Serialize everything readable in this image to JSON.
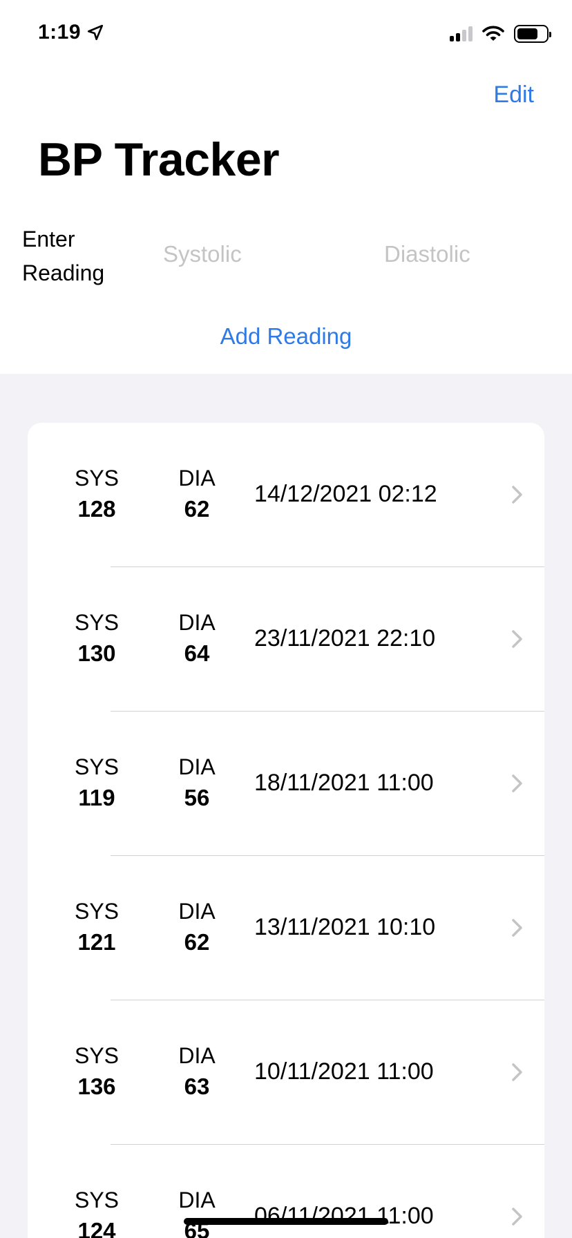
{
  "status_bar": {
    "time": "1:19"
  },
  "nav": {
    "edit_label": "Edit",
    "title": "BP Tracker"
  },
  "entry": {
    "label": "Enter Reading",
    "systolic_placeholder": "Systolic",
    "diastolic_placeholder": "Diastolic",
    "add_label": "Add Reading"
  },
  "readings": [
    {
      "sys_label": "SYS",
      "sys": "128",
      "dia_label": "DIA",
      "dia": "62",
      "date": "14/12/2021 02:12"
    },
    {
      "sys_label": "SYS",
      "sys": "130",
      "dia_label": "DIA",
      "dia": "64",
      "date": "23/11/2021 22:10"
    },
    {
      "sys_label": "SYS",
      "sys": "119",
      "dia_label": "DIA",
      "dia": "56",
      "date": "18/11/2021 11:00"
    },
    {
      "sys_label": "SYS",
      "sys": "121",
      "dia_label": "DIA",
      "dia": "62",
      "date": "13/11/2021 10:10"
    },
    {
      "sys_label": "SYS",
      "sys": "136",
      "dia_label": "DIA",
      "dia": "63",
      "date": "10/11/2021 11:00"
    },
    {
      "sys_label": "SYS",
      "sys": "124",
      "dia_label": "DIA",
      "dia": "65",
      "date": "06/11/2021 11:00"
    }
  ],
  "colors": {
    "accent": "#2f7ae5",
    "background": "#f2f2f7",
    "placeholder": "#c4c4c6"
  }
}
